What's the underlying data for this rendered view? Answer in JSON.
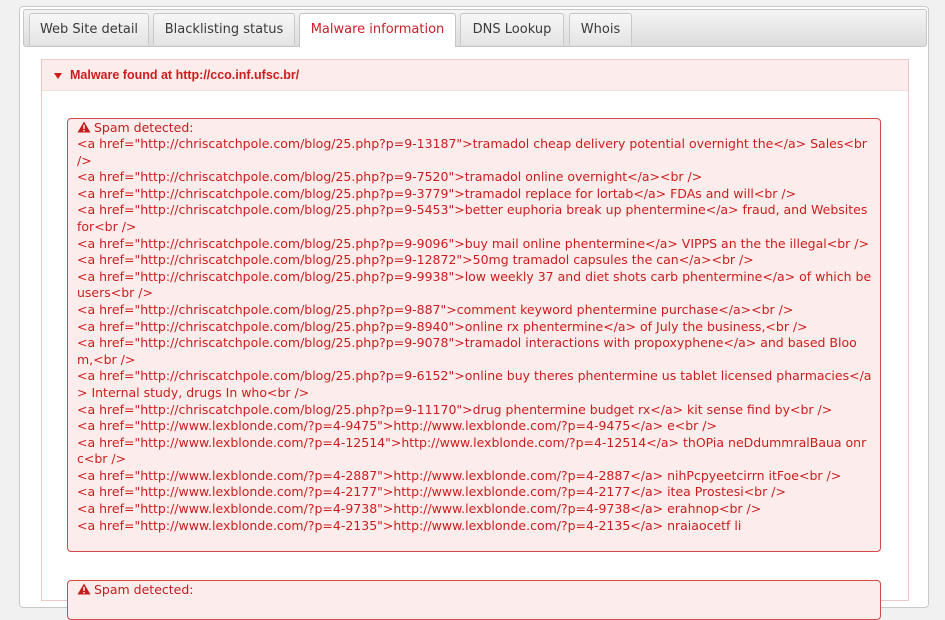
{
  "tabs": [
    {
      "label": "Web Site detail",
      "active": false
    },
    {
      "label": "Blacklisting status",
      "active": false
    },
    {
      "label": "Malware information",
      "active": true
    },
    {
      "label": "DNS Lookup",
      "active": false
    },
    {
      "label": "Whois",
      "active": false
    }
  ],
  "section": {
    "title": "Malware found at http://cco.inf.ufsc.br/"
  },
  "alerts": [
    {
      "title": "Spam detected:",
      "lines": [
        "<a href=\"http://chriscatchpole.com/blog/25.php?p=9-13187\">tramadol cheap delivery potential overnight the</a> Sales<br />",
        "<a href=\"http://chriscatchpole.com/blog/25.php?p=9-7520\">tramadol online overnight</a><br />",
        "<a href=\"http://chriscatchpole.com/blog/25.php?p=9-3779\">tramadol replace for lortab</a> FDAs and will<br />",
        "<a href=\"http://chriscatchpole.com/blog/25.php?p=9-5453\">better euphoria break up phentermine</a> fraud, and Websites for<br />",
        "<a href=\"http://chriscatchpole.com/blog/25.php?p=9-9096\">buy mail online phentermine</a> VIPPS an the the illegal<br />",
        "<a href=\"http://chriscatchpole.com/blog/25.php?p=9-12872\">50mg tramadol capsules the can</a><br />",
        "<a href=\"http://chriscatchpole.com/blog/25.php?p=9-9938\">low weekly 37 and diet shots carb phentermine</a> of which be users<br />",
        "<a href=\"http://chriscatchpole.com/blog/25.php?p=9-887\">comment keyword phentermine purchase</a><br />",
        "<a href=\"http://chriscatchpole.com/blog/25.php?p=9-8940\">online rx phentermine</a> of July the business,<br />",
        "<a href=\"http://chriscatchpole.com/blog/25.php?p=9-9078\">tramadol interactions with propoxyphene</a> and based Bloom,<br />",
        "<a href=\"http://chriscatchpole.com/blog/25.php?p=9-6152\">online buy theres phentermine us tablet licensed pharmacies</a> Internal study, drugs In who<br />",
        "<a href=\"http://chriscatchpole.com/blog/25.php?p=9-11170\">drug phentermine budget rx</a> kit sense find by<br />",
        "<a href=\"http://www.lexblonde.com/?p=4-9475\">http://www.lexblonde.com/?p=4-9475</a> e<br />",
        "<a href=\"http://www.lexblonde.com/?p=4-12514\">http://www.lexblonde.com/?p=4-12514</a> thOPia neDdummralBaua onrc<br />",
        "<a href=\"http://www.lexblonde.com/?p=4-2887\">http://www.lexblonde.com/?p=4-2887</a> nihPcpyeetcirrn itFoe<br />",
        "<a href=\"http://www.lexblonde.com/?p=4-2177\">http://www.lexblonde.com/?p=4-2177</a> itea Prostesi<br />",
        "<a href=\"http://www.lexblonde.com/?p=4-9738\">http://www.lexblonde.com/?p=4-9738</a> erahnop<br />",
        "<a href=\"http://www.lexblonde.com/?p=4-2135\">http://www.lexblonde.com/?p=4-2135</a> nraiaocetf li"
      ]
    },
    {
      "title": "Spam detected:",
      "lines": []
    }
  ],
  "colors": {
    "accent_red": "#cc1d1d",
    "alert_bg": "#fdecec",
    "alert_border": "#d44a4a"
  },
  "icons": {
    "section_toggle": "triangle-down-icon",
    "alert": "warning-icon"
  }
}
